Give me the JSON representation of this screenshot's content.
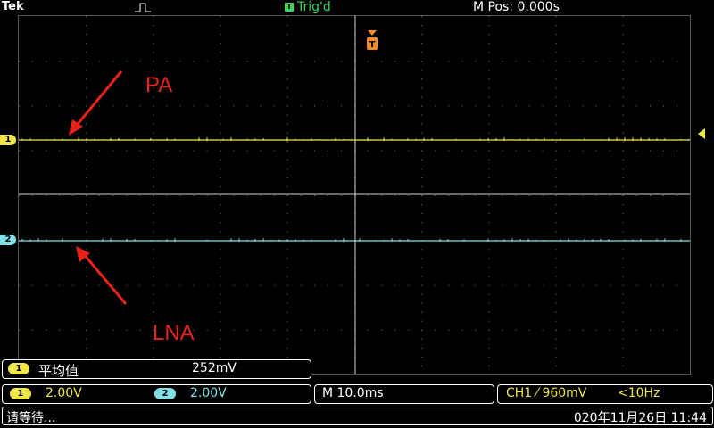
{
  "header": {
    "brand": "Tek",
    "trigger_status": "Trig'd",
    "trigger_status_badge": "T",
    "horizontal_position": "M Pos: 0.000s"
  },
  "screen": {
    "ch1_marker": "1",
    "ch2_marker": "2",
    "annotations": {
      "pa": "PA",
      "lna": "LNA"
    }
  },
  "measurement": {
    "channel": "1",
    "name": "平均值",
    "value": "252mV"
  },
  "vertical": {
    "ch1_badge": "1",
    "ch1_scale": "2.00V",
    "ch2_badge": "2",
    "ch2_scale": "2.00V"
  },
  "horizontal": {
    "timebase": "M 10.0ms"
  },
  "trigger": {
    "source_level": "CH1 ⁄ 960mV",
    "frequency": "<10Hz"
  },
  "status": {
    "message": "请等待...",
    "datetime": "020年11月26日 11:44"
  },
  "colors": {
    "ch1": "#f0e64a",
    "ch2": "#7fe0e8",
    "triggered": "#3cd65a",
    "annotation": "#e8231b",
    "trigger_marker": "#f28c28"
  }
}
